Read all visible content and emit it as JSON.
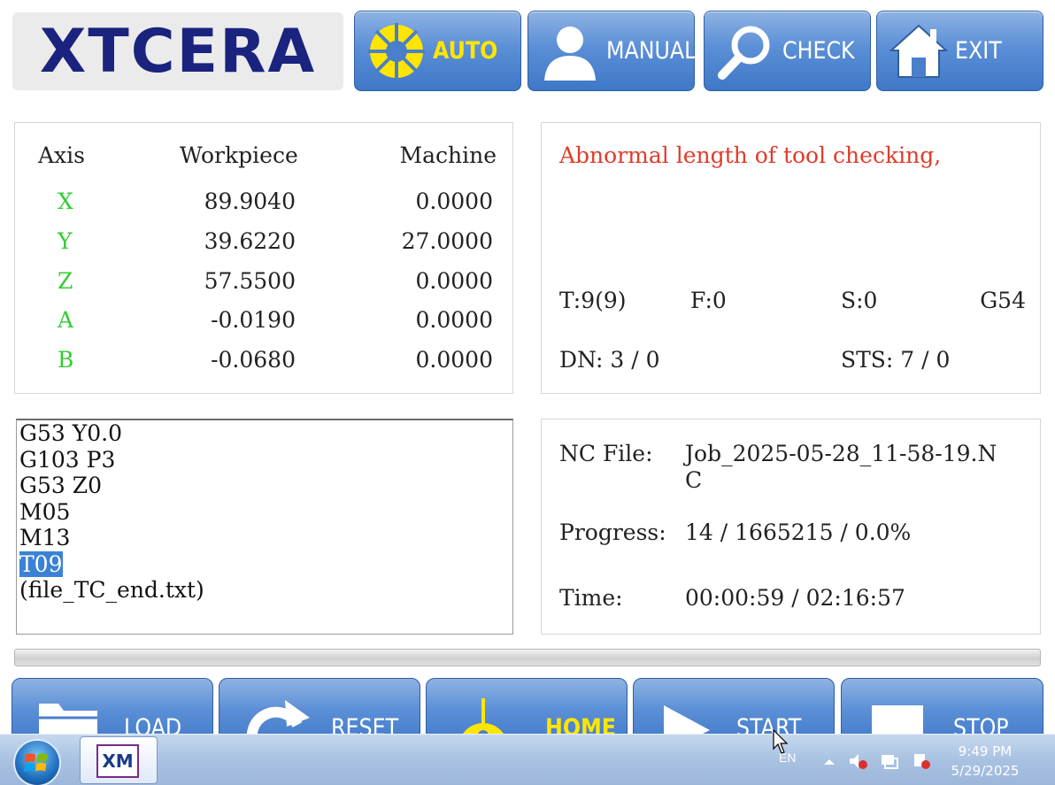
{
  "logo": {
    "text": "XTCERA",
    "color": "#1a237e"
  },
  "top_buttons": [
    {
      "id": "auto",
      "label": "AUTO",
      "icon": "gear-icon",
      "active": true
    },
    {
      "id": "manual",
      "label": "MANUAL",
      "icon": "user-icon",
      "active": false
    },
    {
      "id": "check",
      "label": "CHECK",
      "icon": "magnifier-icon",
      "active": false
    },
    {
      "id": "exit",
      "label": "EXIT",
      "icon": "home-icon",
      "active": false
    }
  ],
  "axes": {
    "headers": {
      "axis": "Axis",
      "workpiece": "Workpiece",
      "machine": "Machine"
    },
    "rows": [
      {
        "axis": "X",
        "workpiece": "89.9040",
        "machine": "0.0000"
      },
      {
        "axis": "Y",
        "workpiece": "39.6220",
        "machine": "27.0000"
      },
      {
        "axis": "Z",
        "workpiece": "57.5500",
        "machine": "0.0000"
      },
      {
        "axis": "A",
        "workpiece": "-0.0190",
        "machine": "0.0000"
      },
      {
        "axis": "B",
        "workpiece": "-0.0680",
        "machine": "0.0000"
      }
    ]
  },
  "status": {
    "message": "Abnormal length of tool checking,",
    "message_color": "#e03b2a",
    "tool": "T:9(9)",
    "feed": "F:0",
    "spindle": "S:0",
    "coord_system": "G54",
    "dn": "DN: 3 / 0",
    "sts": "STS: 7 / 0"
  },
  "gcode": {
    "lines": [
      "G53 Y0.0",
      "G103 P3",
      "G53 Z0",
      "M05",
      "M13",
      "T09",
      "(file_TC_end.txt)"
    ],
    "selected_index": 5
  },
  "job": {
    "nc_label": "NC File:",
    "nc_value": "Job_2025-05-28_11-58-19.N",
    "nc_value_wrap": "C",
    "progress_label": "Progress:",
    "progress_value": "14 / 1665215 / 0.0%",
    "time_label": "Time:",
    "time_value": "00:00:59 / 02:16:57"
  },
  "progress_bar": {
    "fraction": 0.0
  },
  "bottom_buttons": [
    {
      "id": "load",
      "label": "LOAD",
      "icon": "folder-icon"
    },
    {
      "id": "reset",
      "label": "RESET",
      "icon": "refresh-icon"
    },
    {
      "id": "home",
      "label": "HOME",
      "icon": "target-icon"
    },
    {
      "id": "start",
      "label": "START",
      "icon": "play-icon"
    },
    {
      "id": "stop",
      "label": "STOP",
      "icon": "stop-icon"
    }
  ],
  "taskbar": {
    "app_label": "XM",
    "lang": "EN",
    "time": "9:49 PM",
    "date": "5/29/2025"
  }
}
